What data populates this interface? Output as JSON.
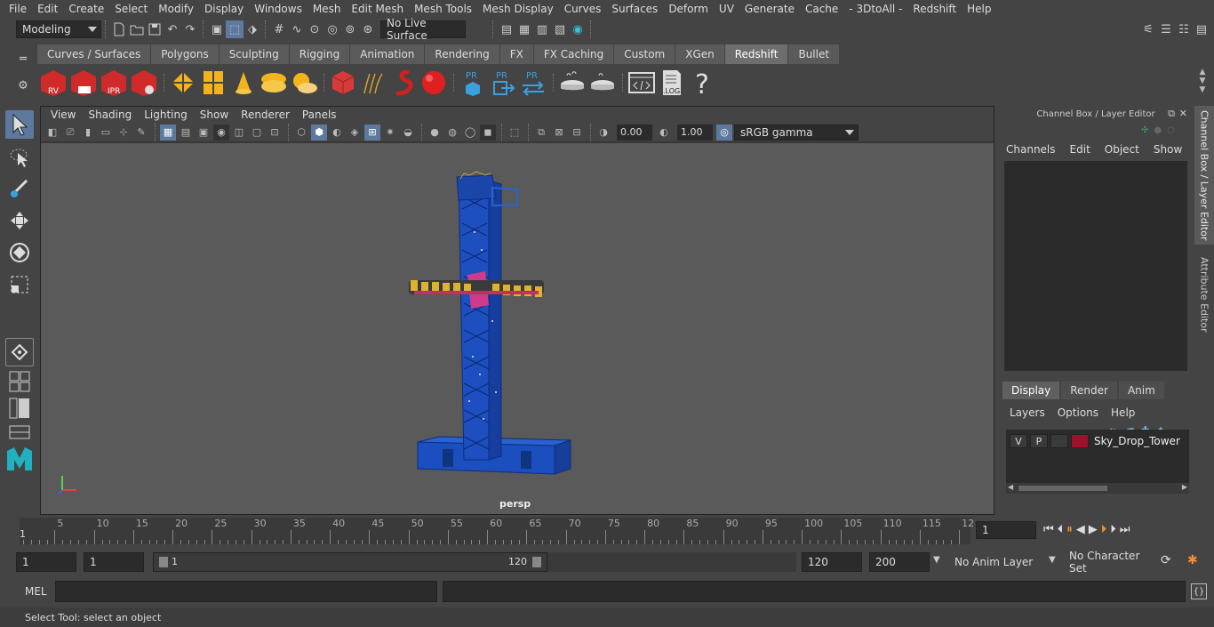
{
  "menubar": {
    "items": [
      "File",
      "Edit",
      "Create",
      "Select",
      "Modify",
      "Display",
      "Windows",
      "Mesh",
      "Edit Mesh",
      "Mesh Tools",
      "Mesh Display",
      "Curves",
      "Surfaces",
      "Deform",
      "UV",
      "Generate",
      "Cache",
      "- 3DtoAll -",
      "Redshift",
      "Help"
    ]
  },
  "statusline": {
    "mode": "Modeling",
    "live_surface": "No Live Surface"
  },
  "shelf": {
    "tabs": [
      "Curves / Surfaces",
      "Polygons",
      "Sculpting",
      "Rigging",
      "Animation",
      "Rendering",
      "FX",
      "FX Caching",
      "Custom",
      "XGen",
      "Redshift",
      "Bullet"
    ],
    "active_tab": "Redshift",
    "icon_labels": {
      "rv": "RV",
      "ipr": "IPR",
      "pr1": "PR",
      "pr2": "PR",
      "pr3": "PR",
      "log": ".LOG",
      "help": "?"
    }
  },
  "viewport": {
    "menu": [
      "View",
      "Shading",
      "Lighting",
      "Show",
      "Renderer",
      "Panels"
    ],
    "exposure": "0.00",
    "gamma": "1.00",
    "colorspace": "sRGB gamma",
    "camera_label": "persp",
    "accent": "#5d7a9e"
  },
  "channelbox": {
    "title": "Channel Box / Layer Editor",
    "menu": [
      "Channels",
      "Edit",
      "Object",
      "Show"
    ],
    "layer_tabs": [
      "Display",
      "Render",
      "Anim"
    ],
    "active_layer_tab": "Display",
    "layer_menu": [
      "Layers",
      "Options",
      "Help"
    ],
    "layer": {
      "v": "V",
      "p": "P",
      "name": "Sky_Drop_Tower",
      "color": "#a0102a"
    }
  },
  "side_tabs": [
    "Channel Box / Layer Editor",
    "Attribute Editor"
  ],
  "timeline": {
    "ticks": [
      "5",
      "10",
      "15",
      "20",
      "25",
      "30",
      "35",
      "40",
      "45",
      "50",
      "55",
      "60",
      "65",
      "70",
      "75",
      "80",
      "85",
      "90",
      "95",
      "100",
      "105",
      "110",
      "115",
      "12"
    ],
    "start_label": "1",
    "current_frame": "1"
  },
  "range": {
    "start": "1",
    "playback_start": "1",
    "slider_start": "1",
    "slider_end": "120",
    "playback_end": "120",
    "end": "200",
    "anim_layer": "No Anim Layer",
    "character_set": "No Character Set"
  },
  "cmdline": {
    "lang": "MEL"
  },
  "helpline": {
    "text": "Select Tool: select an object"
  }
}
